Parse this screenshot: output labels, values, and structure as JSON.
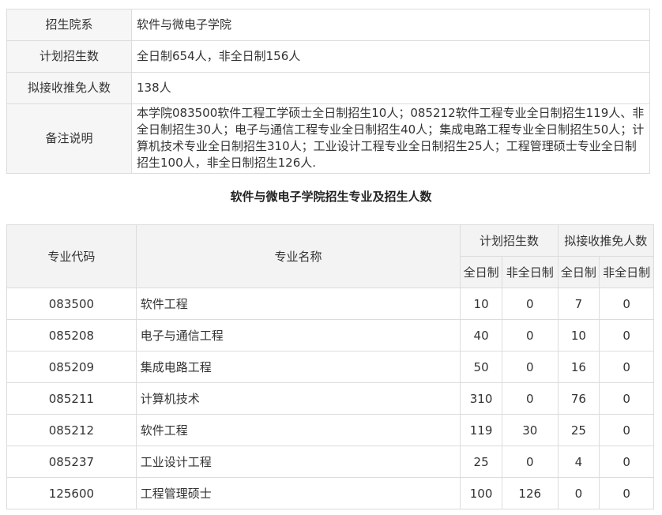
{
  "info": {
    "rows": [
      {
        "label": "招生院系",
        "value": "软件与微电子学院"
      },
      {
        "label": "计划招生数",
        "value": "全日制654人，非全日制156人"
      },
      {
        "label": "拟接收推免人数",
        "value": "138人"
      },
      {
        "label": "备注说明",
        "value": "本学院083500软件工程工学硕士全日制招生10人；085212软件工程专业全日制招生119人、非全日制招生30人；电子与通信工程专业全日制招生40人；集成电路工程专业全日制招生50人；计算机技术专业全日制招生310人；工业设计工程专业全日制招生25人；工程管理硕士专业全日制招生100人，非全日制招生126人."
      }
    ]
  },
  "section_title": "软件与微电子学院招生专业及招生人数",
  "majors": {
    "headers": {
      "code": "专业代码",
      "name": "专业名称",
      "plan": "计划招生数",
      "exempt": "拟接收推免人数",
      "full": "全日制",
      "part": "非全日制"
    },
    "rows": [
      {
        "code": "083500",
        "name": "软件工程",
        "plan_full": "10",
        "plan_part": "0",
        "ex_full": "7",
        "ex_part": "0"
      },
      {
        "code": "085208",
        "name": "电子与通信工程",
        "plan_full": "40",
        "plan_part": "0",
        "ex_full": "10",
        "ex_part": "0"
      },
      {
        "code": "085209",
        "name": "集成电路工程",
        "plan_full": "50",
        "plan_part": "0",
        "ex_full": "16",
        "ex_part": "0"
      },
      {
        "code": "085211",
        "name": "计算机技术",
        "plan_full": "310",
        "plan_part": "0",
        "ex_full": "76",
        "ex_part": "0"
      },
      {
        "code": "085212",
        "name": "软件工程",
        "plan_full": "119",
        "plan_part": "30",
        "ex_full": "25",
        "ex_part": "0"
      },
      {
        "code": "085237",
        "name": "工业设计工程",
        "plan_full": "25",
        "plan_part": "0",
        "ex_full": "4",
        "ex_part": "0"
      },
      {
        "code": "125600",
        "name": "工程管理硕士",
        "plan_full": "100",
        "plan_part": "126",
        "ex_full": "0",
        "ex_part": "0"
      }
    ]
  }
}
